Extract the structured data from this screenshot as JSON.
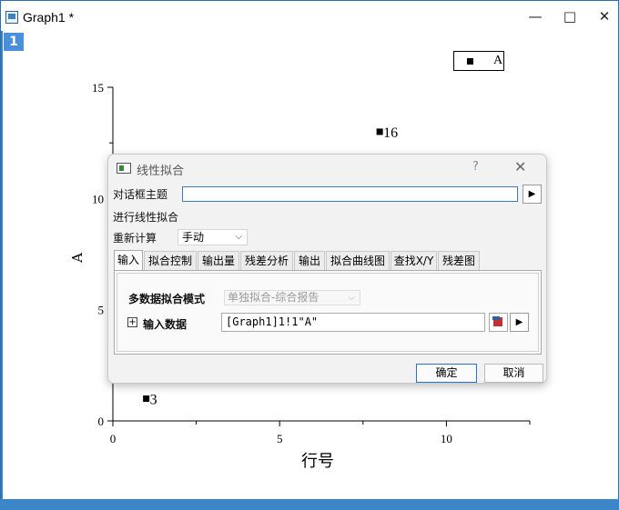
{
  "window": {
    "title": "Graph1 *",
    "minimize": "—",
    "maximize": "□",
    "close": "✕",
    "page_number": "1"
  },
  "legend": {
    "text": "A"
  },
  "chart_data": {
    "type": "scatter",
    "xlabel": "行号",
    "ylabel": "A",
    "xlim": [
      0,
      12.5
    ],
    "ylim": [
      0,
      15
    ],
    "xticks": [
      0,
      5,
      10
    ],
    "yticks": [
      0,
      5,
      10,
      15
    ],
    "series": [
      {
        "name": "A",
        "points": [
          {
            "x": 1,
            "y": 1,
            "label": "3"
          },
          {
            "x": 8,
            "y": 13,
            "label": "16"
          }
        ]
      }
    ]
  },
  "dialog": {
    "title": "线性拟合",
    "help": "?",
    "close": "✕",
    "theme_label": "对话框主题",
    "theme_value": "",
    "action_label": "进行线性拟合",
    "recalc_label": "重新计算",
    "recalc_value": "手动",
    "tabs": [
      "输入",
      "拟合控制",
      "输出量",
      "残差分析",
      "输出",
      "拟合曲线图",
      "查找X/Y",
      "残差图"
    ],
    "multi_mode_label": "多数据拟合模式",
    "multi_mode_value": "单独拟合-综合报告",
    "input_data_label": "输入数据",
    "input_data_value": "[Graph1]1!1\"A\"",
    "ok": "确定",
    "cancel": "取消"
  }
}
